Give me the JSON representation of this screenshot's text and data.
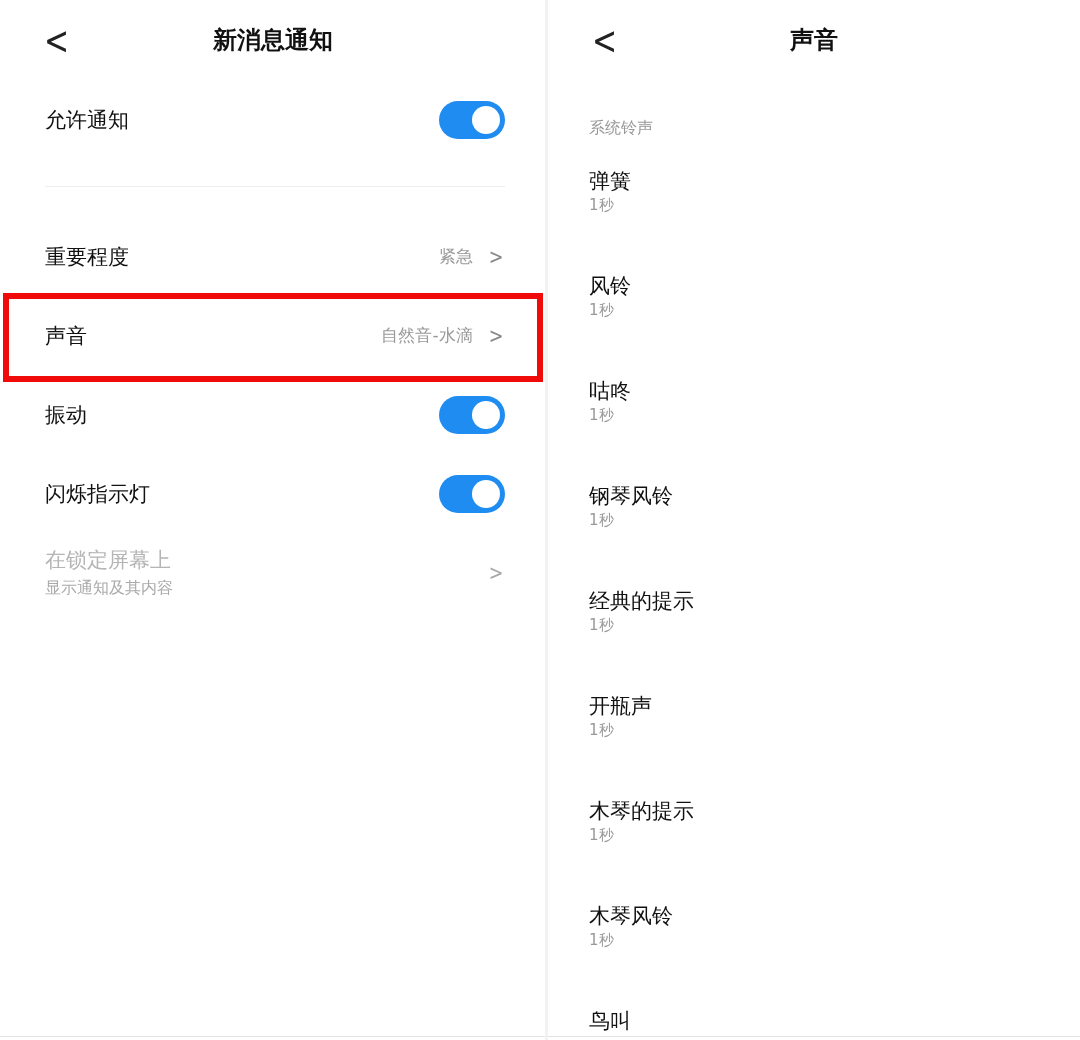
{
  "notification_screen": {
    "back": "<",
    "title": "新消息通知",
    "rows": [
      {
        "kind": "toggle",
        "label": "允许通知",
        "on": true,
        "divider_after": true
      },
      {
        "kind": "link",
        "label": "重要程度",
        "value": "紧急",
        "arrow": ">"
      },
      {
        "kind": "link",
        "label": "声音",
        "value": "自然音-水滴",
        "arrow": ">",
        "highlighted": true
      },
      {
        "kind": "toggle",
        "label": "振动",
        "on": true
      },
      {
        "kind": "toggle",
        "label": "闪烁指示灯",
        "on": true
      },
      {
        "kind": "link",
        "label": "在锁定屏幕上",
        "subtitle": "显示通知及其内容",
        "arrow": ">",
        "disabled": true
      }
    ]
  },
  "sound_screen": {
    "back": "<",
    "title": "声音",
    "section": "系统铃声",
    "items": [
      {
        "name": "弹簧",
        "duration": "1秒"
      },
      {
        "name": "风铃",
        "duration": "1秒"
      },
      {
        "name": "咕咚",
        "duration": "1秒"
      },
      {
        "name": "钢琴风铃",
        "duration": "1秒"
      },
      {
        "name": "经典的提示",
        "duration": "1秒"
      },
      {
        "name": "开瓶声",
        "duration": "1秒"
      },
      {
        "name": "木琴的提示",
        "duration": "1秒"
      },
      {
        "name": "木琴风铃",
        "duration": "1秒"
      },
      {
        "name": "鸟叫"
      }
    ]
  }
}
